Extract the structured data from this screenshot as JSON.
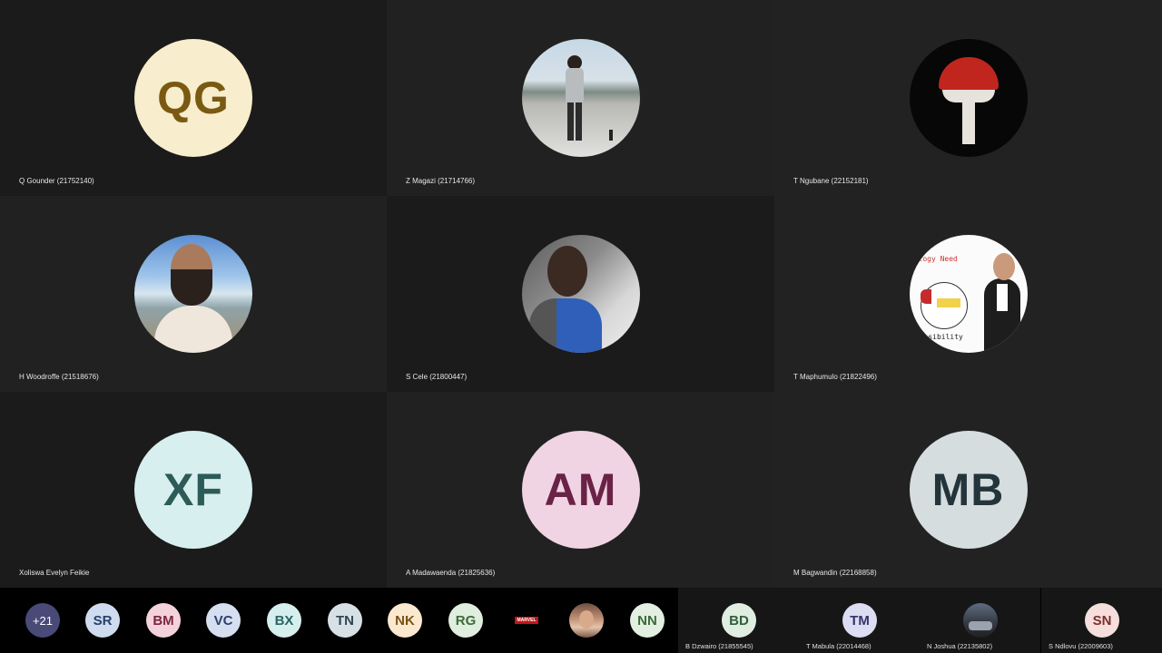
{
  "grid": [
    {
      "name": "Q Gounder (21752140)",
      "initials": "QG",
      "avatar_bg": "#f8edcc",
      "avatar_fg": "#7a5a12",
      "photo": false
    },
    {
      "name": "Z Magazi (21714766)",
      "initials": "",
      "photo": true,
      "photo_kind": "rooftop-person"
    },
    {
      "name": "T Ngubane (22152181)",
      "initials": "",
      "photo": true,
      "photo_kind": "red-white-emblem"
    },
    {
      "name": "H Woodroffe (21518676)",
      "initials": "",
      "photo": true,
      "photo_kind": "beach-selfie"
    },
    {
      "name": "S Cele (21800447)",
      "initials": "",
      "photo": true,
      "photo_kind": "indoor-selfie"
    },
    {
      "name": "T Maphumulo (21822496)",
      "initials": "",
      "photo": true,
      "photo_kind": "slide-with-presenter",
      "slide_text_top": "logy Need",
      "slide_text_bottom": "asibility"
    },
    {
      "name": "Xoliswa Evelyn Feikie",
      "initials": "XF",
      "avatar_bg": "#d8efef",
      "avatar_fg": "#2d5b58",
      "photo": false
    },
    {
      "name": "A Madawaenda (21825636)",
      "initials": "AM",
      "avatar_bg": "#f0d4e3",
      "avatar_fg": "#6b2247",
      "photo": false
    },
    {
      "name": "M Bagwandin (22168858)",
      "initials": "MB",
      "avatar_bg": "#d6dddf",
      "avatar_fg": "#23353a",
      "photo": false
    }
  ],
  "strip": [
    {
      "label": "+21",
      "bg": "#4a4a78",
      "fg": "#ffffff",
      "kind": "overflow-count"
    },
    {
      "label": "SR",
      "bg": "#cfdcef",
      "fg": "#26406b"
    },
    {
      "label": "BM",
      "bg": "#f4d2dc",
      "fg": "#7a2541"
    },
    {
      "label": "VC",
      "bg": "#d6dff0",
      "fg": "#2c3f6e"
    },
    {
      "label": "BX",
      "bg": "#d6eeee",
      "fg": "#2a6562"
    },
    {
      "label": "TN",
      "bg": "#d7e1e5",
      "fg": "#2e4650"
    },
    {
      "label": "NK",
      "bg": "#fbe9cf",
      "fg": "#7a5314"
    },
    {
      "label": "RG",
      "bg": "#dfeede",
      "fg": "#3b6b39"
    },
    {
      "label": "MARVEL",
      "bg": "#000000",
      "fg": "#ffffff",
      "kind": "logo"
    },
    {
      "label": "",
      "bg": "#8c6a58",
      "fg": "#ffffff",
      "kind": "photo"
    },
    {
      "label": "NN",
      "bg": "#e2efe1",
      "fg": "#3a6b37"
    }
  ],
  "bottom_tiles": [
    {
      "name": "B Dzwairo (21855545)",
      "initials": "BD",
      "bg": "#dfeee0",
      "fg": "#2f5f3b",
      "kind": "initials"
    },
    {
      "name": "T Mabula (22014468)",
      "initials": "TM",
      "bg": "#dcdcf2",
      "fg": "#33336b",
      "kind": "initials"
    },
    {
      "name": "N Joshua (22135802)",
      "initials": "",
      "bg": "#445",
      "fg": "#fff",
      "kind": "photo"
    },
    {
      "name": "S Ndlovu (22009603)",
      "initials": "SN",
      "bg": "#f6dedd",
      "fg": "#7a2f2a",
      "kind": "initials"
    }
  ]
}
